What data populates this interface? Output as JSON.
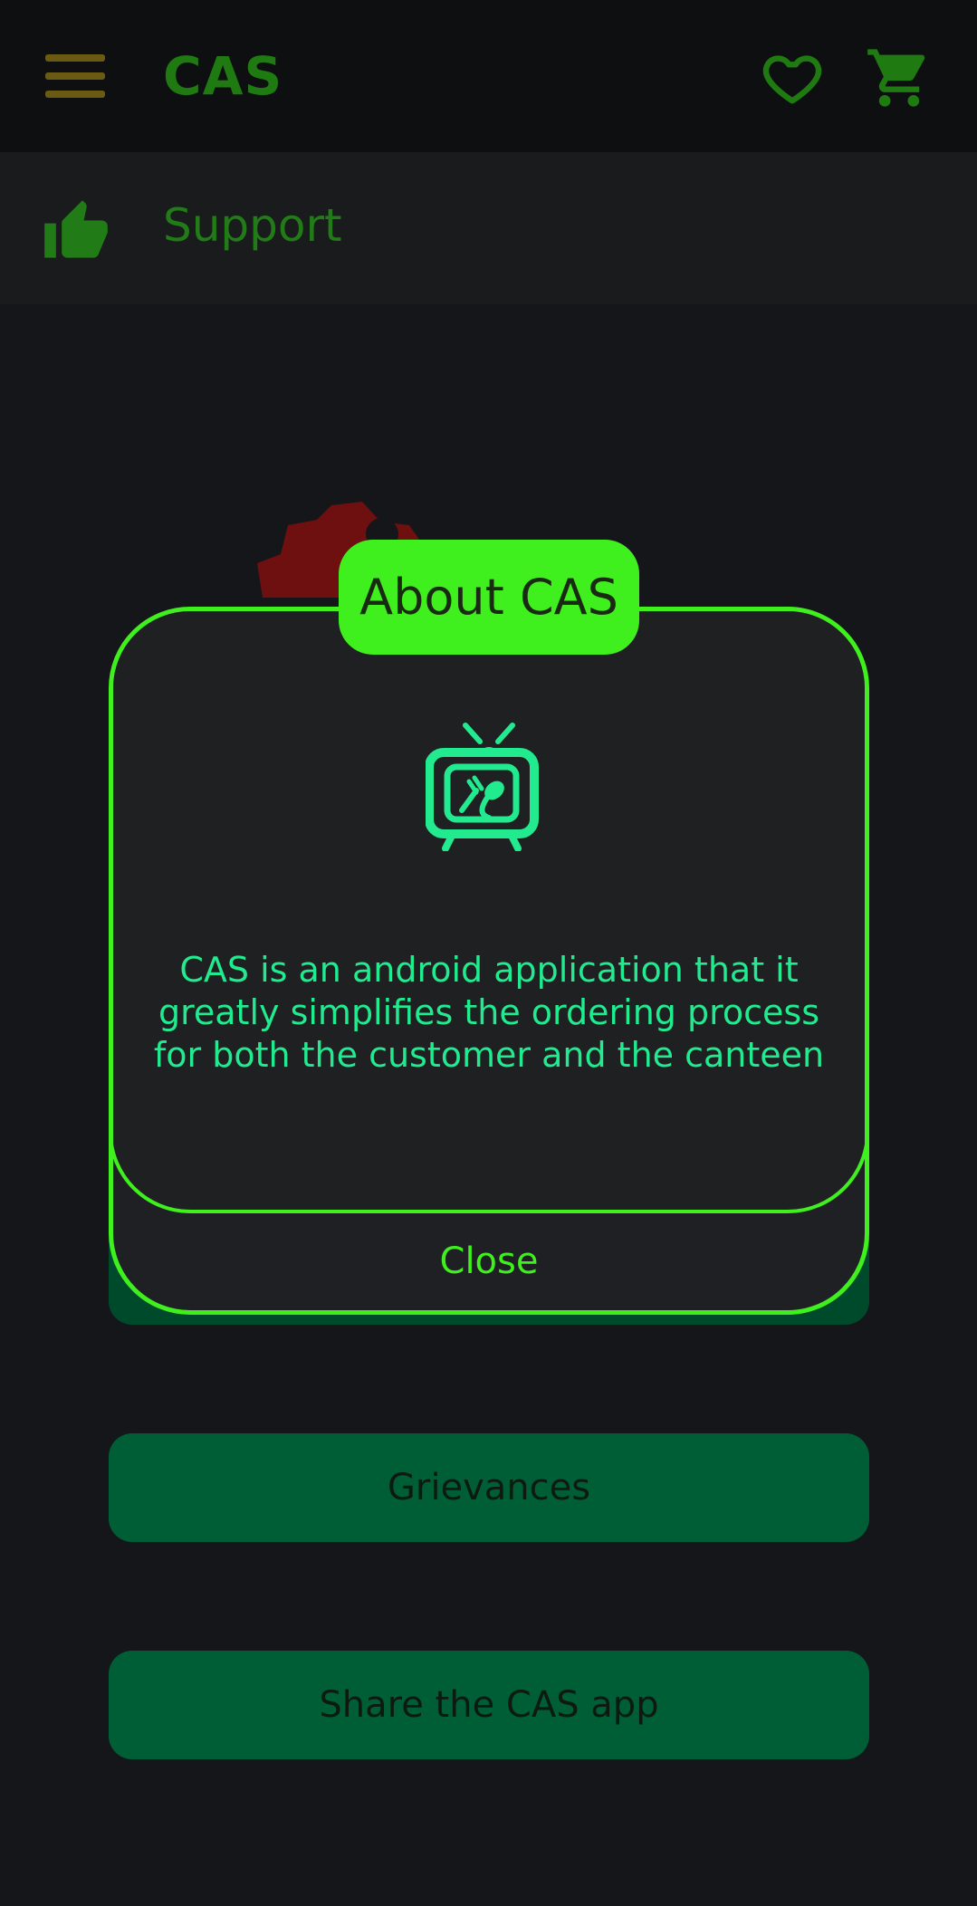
{
  "appbar": {
    "title": "CAS",
    "menu_icon": "hamburger-menu-icon",
    "favorites_icon": "heart-icon",
    "cart_icon": "shopping-cart-icon"
  },
  "section": {
    "icon": "thumbs-up-icon",
    "label": "Support"
  },
  "buttons": {
    "grievances": "Grievances",
    "share": "Share the CAS app"
  },
  "dialog": {
    "title": "About CAS",
    "icon": "tv-food-logo-icon",
    "message": "CAS is an android application that it greatly simplifies the ordering process for both the customer and the canteen",
    "close_label": "Close"
  },
  "colors": {
    "accent": "#3ff01e",
    "teal_text": "#21ea8f",
    "button_green": "#005e37",
    "background": "#151619"
  }
}
